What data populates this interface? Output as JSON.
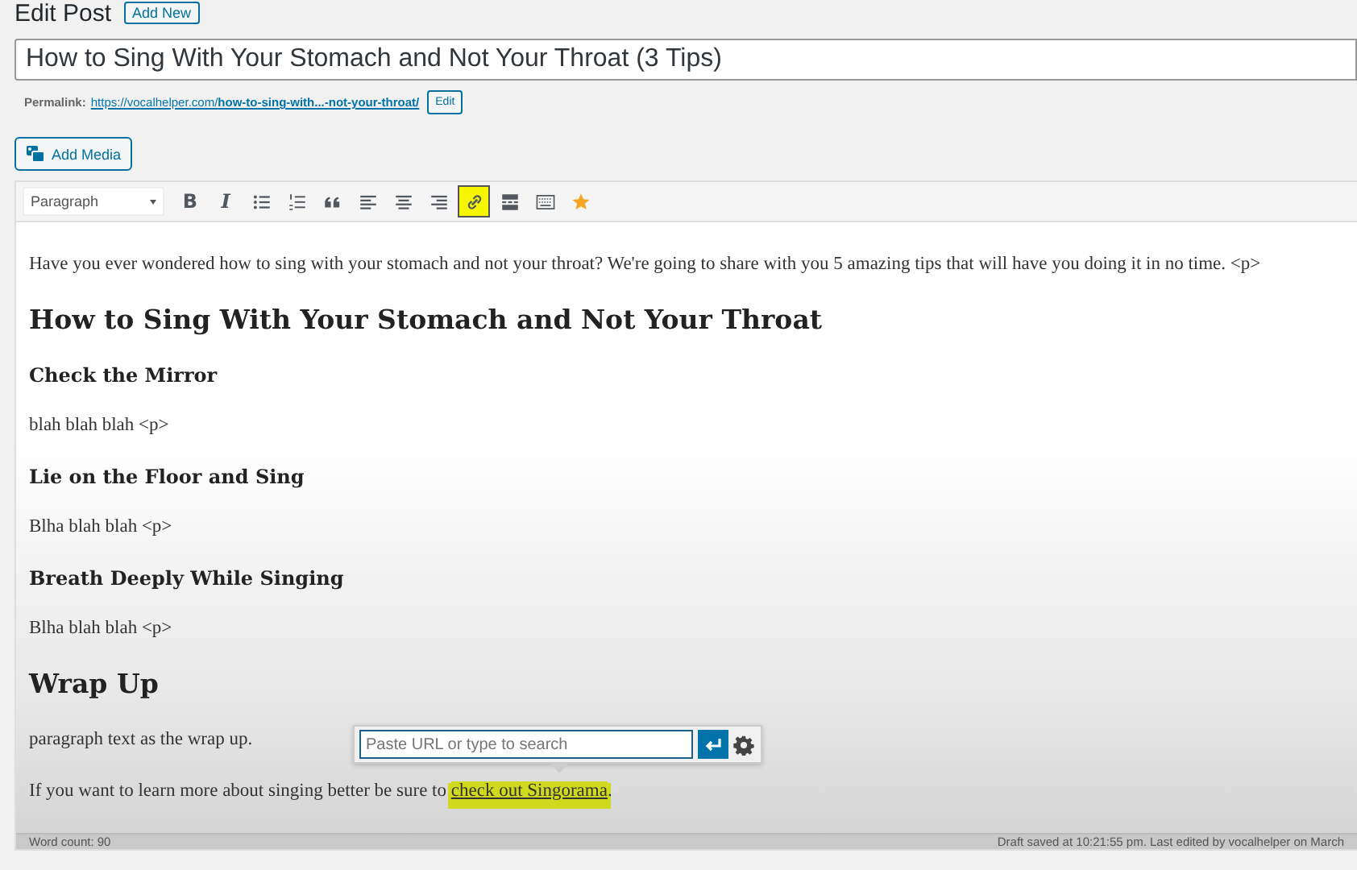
{
  "header": {
    "title": "Edit Post",
    "add_new": "Add New"
  },
  "post_title": {
    "value": "How to Sing With Your Stomach and Not Your Throat (3 Tips)"
  },
  "permalink": {
    "label": "Permalink:",
    "url_start": "https://vocalhelper.com/",
    "url_slug": "how-to-sing-with...-not-your-throat/",
    "edit": "Edit"
  },
  "add_media": "Add Media",
  "toolbar": [
    {
      "kind": "format",
      "label": "Paragraph"
    },
    {
      "kind": "bold",
      "label": "B",
      "active": false
    },
    {
      "kind": "italic",
      "label": "I",
      "active": false
    },
    {
      "kind": "bullets",
      "active": false
    },
    {
      "kind": "numbers",
      "active": false
    },
    {
      "kind": "quote",
      "active": false
    },
    {
      "kind": "align-left",
      "active": false
    },
    {
      "kind": "align-center",
      "active": false
    },
    {
      "kind": "align-right",
      "active": false
    },
    {
      "kind": "link",
      "active": true
    },
    {
      "kind": "more",
      "active": false
    },
    {
      "kind": "kitchen",
      "active": false
    },
    {
      "kind": "star",
      "active": false
    }
  ],
  "content": [
    {
      "kind": "p",
      "text": "Have you ever wondered how to sing with your stomach and not your throat? We're going to share with you 5 amazing tips that will have you doing it in no time. <p>"
    },
    {
      "kind": "h2",
      "text": "How to Sing With Your Stomach and Not Your Throat"
    },
    {
      "kind": "h3",
      "text": "Check the Mirror"
    },
    {
      "kind": "p",
      "text": "blah blah blah <p>"
    },
    {
      "kind": "h3",
      "text": "Lie on the Floor and Sing"
    },
    {
      "kind": "p",
      "text": "Blha blah blah <p>"
    },
    {
      "kind": "h3",
      "text": "Breath Deeply While Singing"
    },
    {
      "kind": "p",
      "text": "Blha blah blah <p>"
    },
    {
      "kind": "h2",
      "text": "Wrap Up"
    },
    {
      "kind": "p",
      "text": "paragraph text as the wrap up."
    },
    {
      "kind": "link-p",
      "text": "If you want to learn more about singing better be sure to ",
      "link": "check out Singorama",
      "after": ".",
      "highlighted": true
    }
  ],
  "link_popover": {
    "placeholder": "Paste URL or type to search"
  },
  "status_bar": {
    "word_count": "Word count: 90",
    "saved": "Draft saved at 10:21:55 pm. Last edited by vocalhelper on March"
  }
}
